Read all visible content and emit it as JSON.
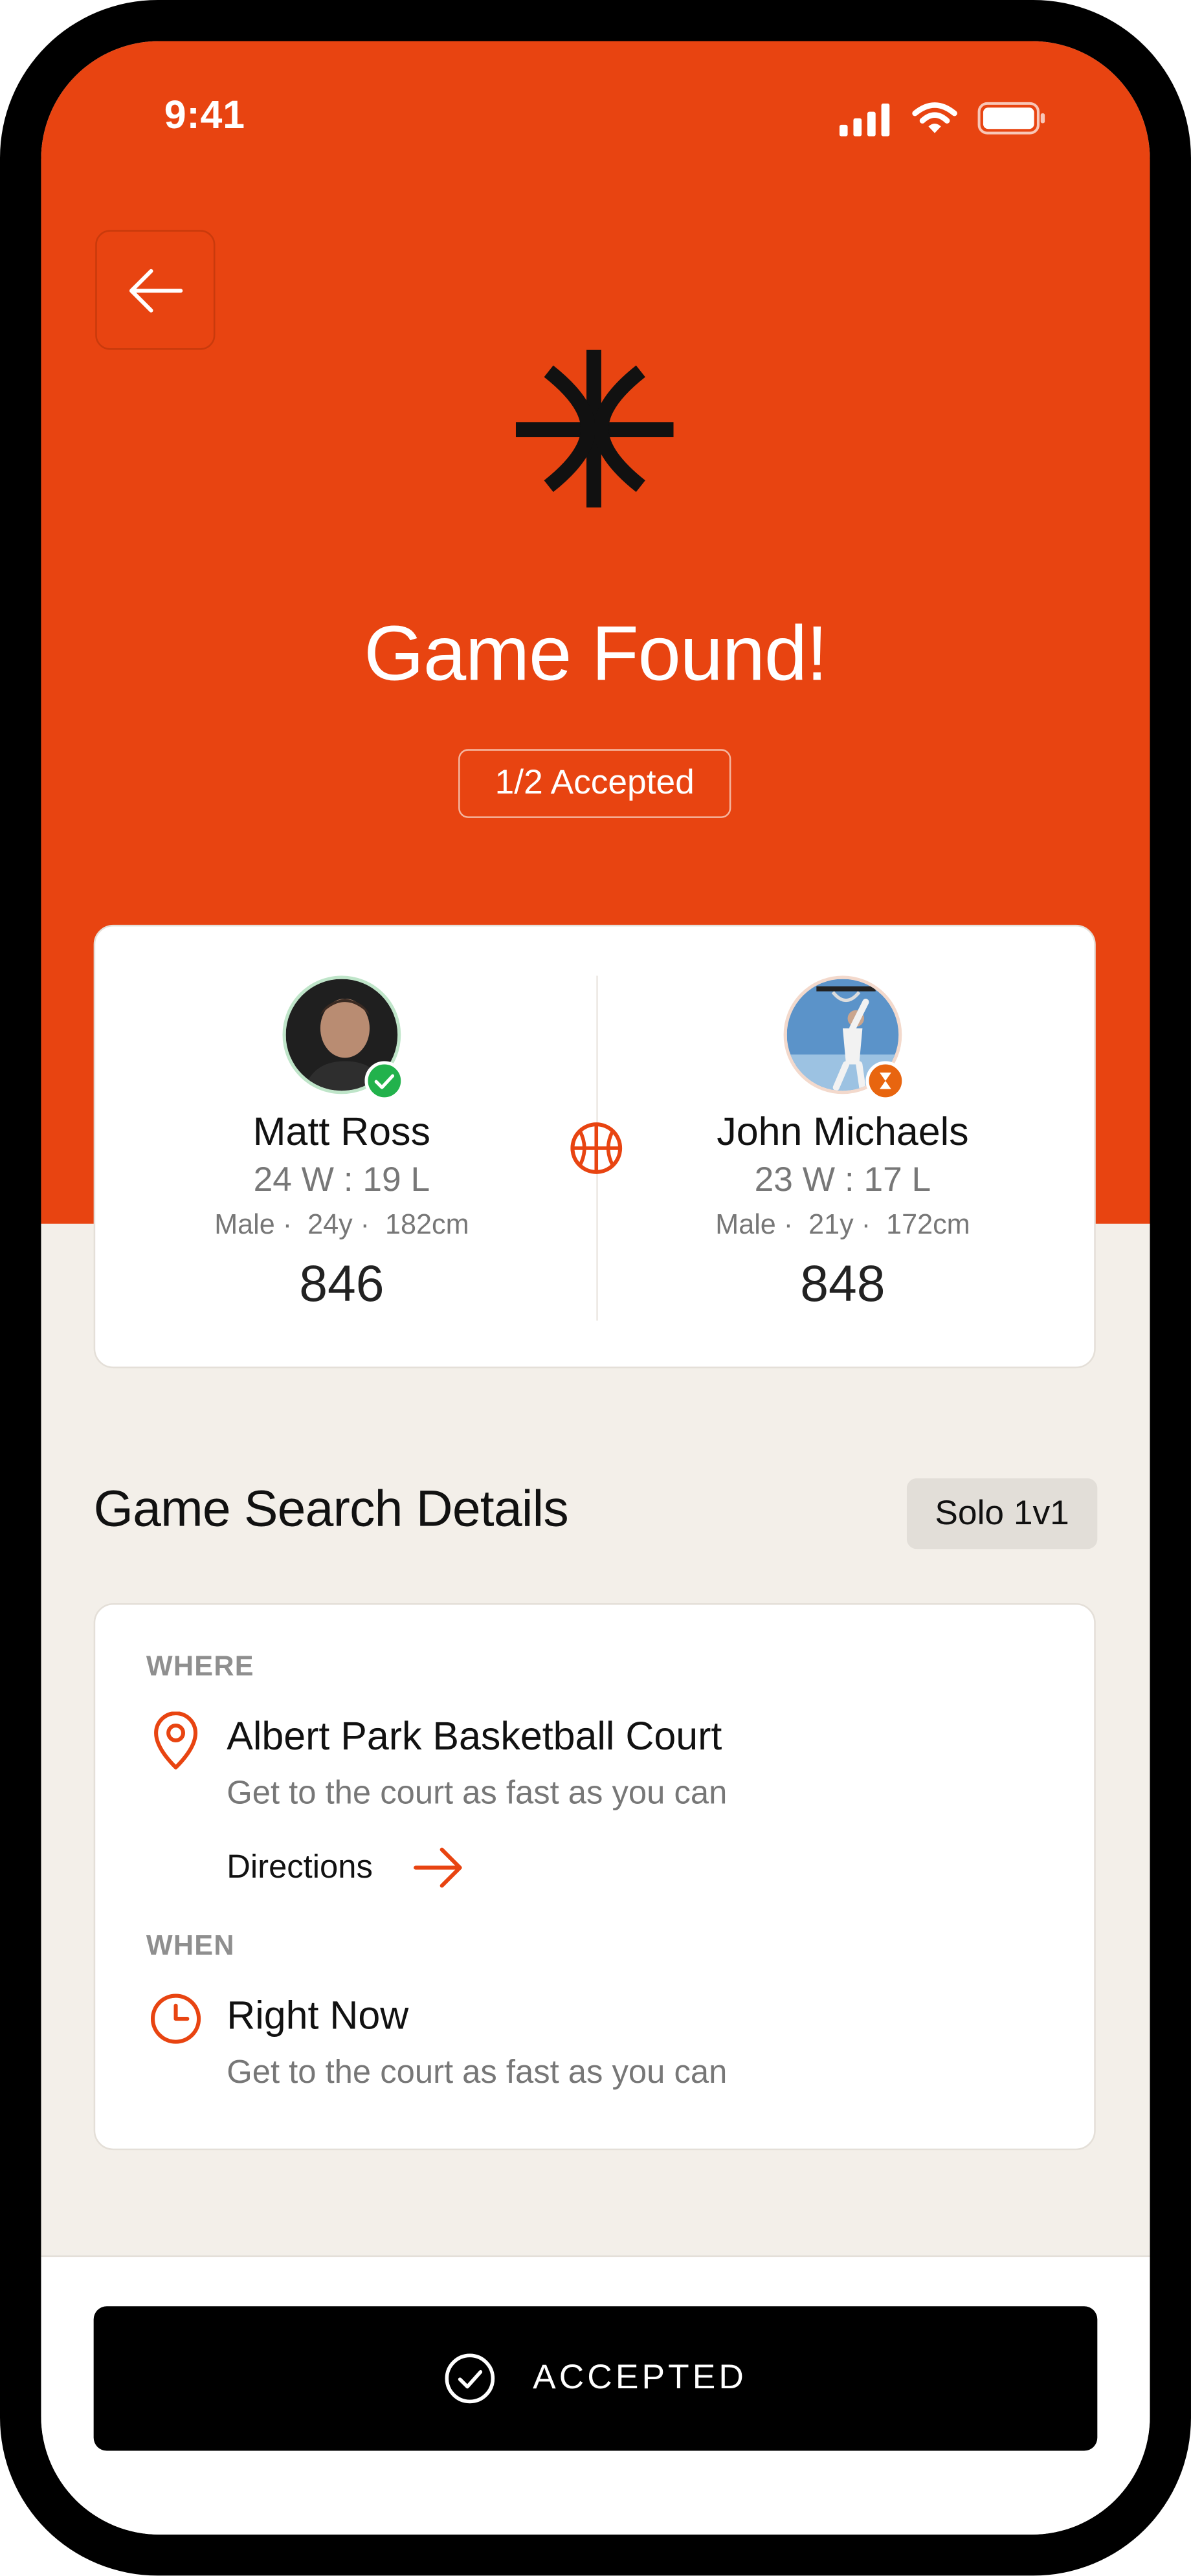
{
  "status_bar": {
    "time": "9:41"
  },
  "header": {
    "title": "Game Found!",
    "accepted_status": "1/2 Accepted"
  },
  "players": [
    {
      "name": "Matt Ross",
      "record": "24 W : 19 L",
      "gender": "Male",
      "age": "24y",
      "height": "182cm",
      "rating": "846",
      "status": "accepted"
    },
    {
      "name": "John Michaels",
      "record": "23 W : 17 L",
      "gender": "Male",
      "age": "21y",
      "height": "172cm",
      "rating": "848",
      "status": "pending"
    }
  ],
  "details": {
    "section_title": "Game Search Details",
    "mode": "Solo 1v1",
    "where_label": "WHERE",
    "location_name": "Albert Park Basketball Court",
    "location_hint": "Get to the court as fast as you can",
    "directions_label": "Directions",
    "when_label": "WHEN",
    "time_value": "Right Now",
    "time_hint": "Get to the court as fast as you can"
  },
  "footer": {
    "accept_label": "ACCEPTED"
  },
  "icons": [
    "back-arrow-icon",
    "brand-logo-icon",
    "basketball-icon",
    "location-pin-icon",
    "arrow-right-icon",
    "clock-icon",
    "check-circle-icon",
    "signal-icon",
    "wifi-icon",
    "battery-icon",
    "check-badge-icon",
    "hourglass-badge-icon"
  ],
  "colors": {
    "brand": "#E84411",
    "background": "#F3EFE9",
    "accepted": "#22B24C",
    "text": "#111111"
  }
}
